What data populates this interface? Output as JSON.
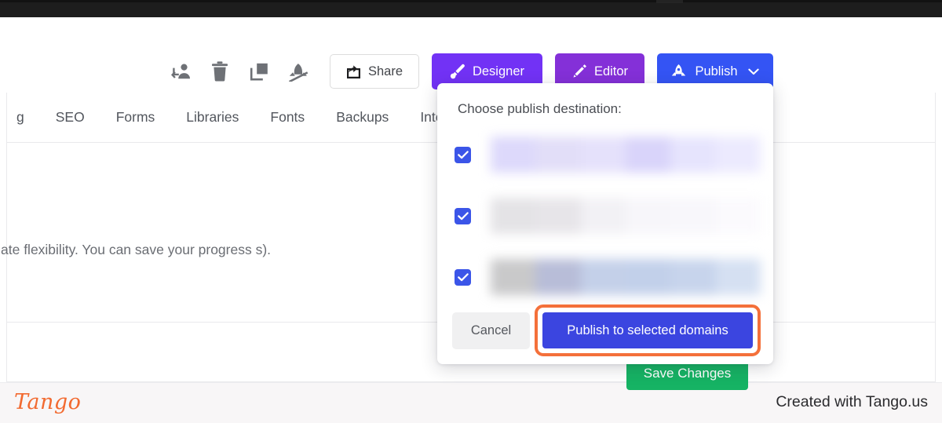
{
  "window": {
    "chrome_bar_color": "#1d1d1d"
  },
  "toolbar": {
    "icons": [
      {
        "name": "revoke-access-icon",
        "label": "Revoke access"
      },
      {
        "name": "delete-icon",
        "label": "Delete"
      },
      {
        "name": "duplicate-icon",
        "label": "Duplicate"
      },
      {
        "name": "unpublish-icon",
        "label": "Unpublish"
      }
    ],
    "share_label": "Share",
    "designer_label": "Designer",
    "editor_label": "Editor",
    "publish_label": "Publish",
    "colors": {
      "designer": "#7232f5",
      "editor": "#8430d8",
      "publish": "#3454f4",
      "share_border": "#dddddd"
    }
  },
  "nav": {
    "items": [
      {
        "label": "g"
      },
      {
        "label": "SEO"
      },
      {
        "label": "Forms"
      },
      {
        "label": "Libraries"
      },
      {
        "label": "Fonts"
      },
      {
        "label": "Backups"
      },
      {
        "label": "Integ"
      }
    ]
  },
  "content": {
    "body_text": "ate flexibility. You can save your progress s).",
    "save_changes_label": "Save Changes",
    "save_changes_color": "#16b364"
  },
  "publish_dialog": {
    "title": "Choose publish destination:",
    "domains": [
      {
        "name": "",
        "checked": true,
        "redacted": true
      },
      {
        "name": "",
        "checked": true,
        "redacted": true
      },
      {
        "name": "",
        "checked": true,
        "redacted": true
      }
    ],
    "cancel_label": "Cancel",
    "publish_label": "Publish to selected domains",
    "colors": {
      "checkbox": "#3b55e8",
      "primary_button": "#3b45e0",
      "cancel_button": "#f0f0f1",
      "highlight": "#f4703a"
    }
  },
  "footer": {
    "logo_text": "Tango",
    "credit_text": "Created with Tango.us",
    "logo_color": "#f26a30",
    "background": "#f8f6f7"
  }
}
